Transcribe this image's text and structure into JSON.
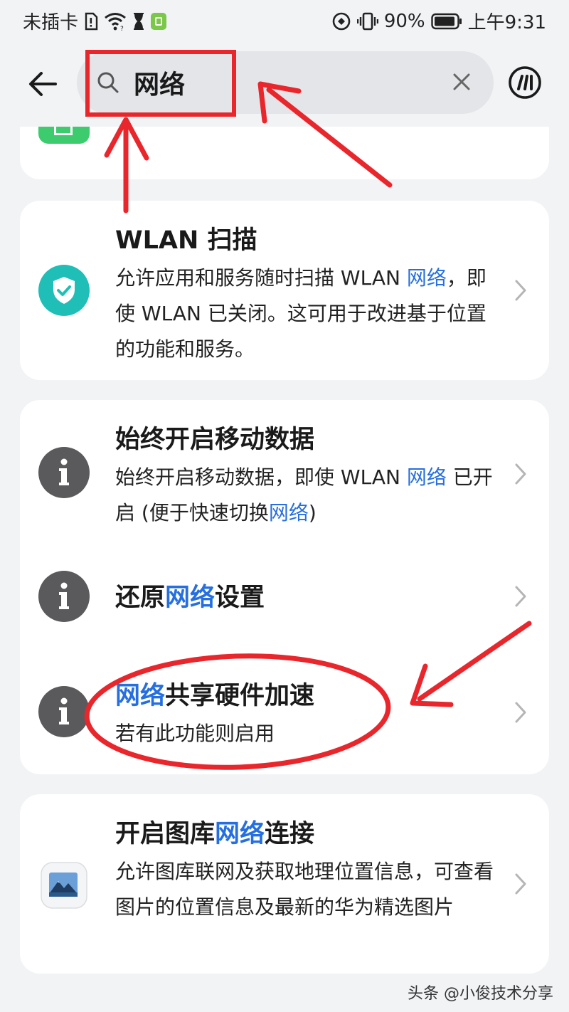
{
  "status_bar": {
    "carrier": "未插卡",
    "battery_percent": "90%",
    "time": "上午9:31"
  },
  "search": {
    "query": "网络",
    "placeholder": ""
  },
  "results": [
    {
      "title_parts": [
        "WLAN 扫描"
      ],
      "subtitle_parts": [
        "允许应用和服务随时扫描 WLAN ",
        "网络",
        "，即使 WLAN 已关闭。这可用于改进基于位置的功能和服务。"
      ]
    },
    {
      "title_parts": [
        "始终开启移动数据"
      ],
      "subtitle_parts": [
        "始终开启移动数据，即使 WLAN ",
        "网络",
        " 已开启 (便于快速切换",
        "网络",
        ")"
      ]
    },
    {
      "title_parts": [
        "还原",
        "网络",
        "设置"
      ]
    },
    {
      "title_parts": [
        "网络",
        "共享硬件加速"
      ],
      "subtitle_parts": [
        "若有此功能则启用"
      ]
    },
    {
      "title_parts": [
        "开启图库",
        "网络",
        "连接"
      ],
      "subtitle_parts": [
        "允许图库联网及获取地理位置信息，可查看图片的位置信息及最新的华为精选图片"
      ]
    }
  ],
  "watermark": "头条 @小俊技术分享",
  "colors": {
    "accent": "#256fe0",
    "annotation": "#e8262b",
    "icon_teal": "#1fbfb8",
    "icon_gray": "#5a5a5c",
    "icon_green": "#3ccc6e"
  },
  "icons": {
    "back": "back-arrow-icon",
    "search": "search-icon",
    "clear": "close-icon",
    "assistant": "ai-assistant-icon",
    "shield": "shield-check-icon",
    "info": "info-icon",
    "gallery": "gallery-icon",
    "chevron": "chevron-right-icon"
  }
}
